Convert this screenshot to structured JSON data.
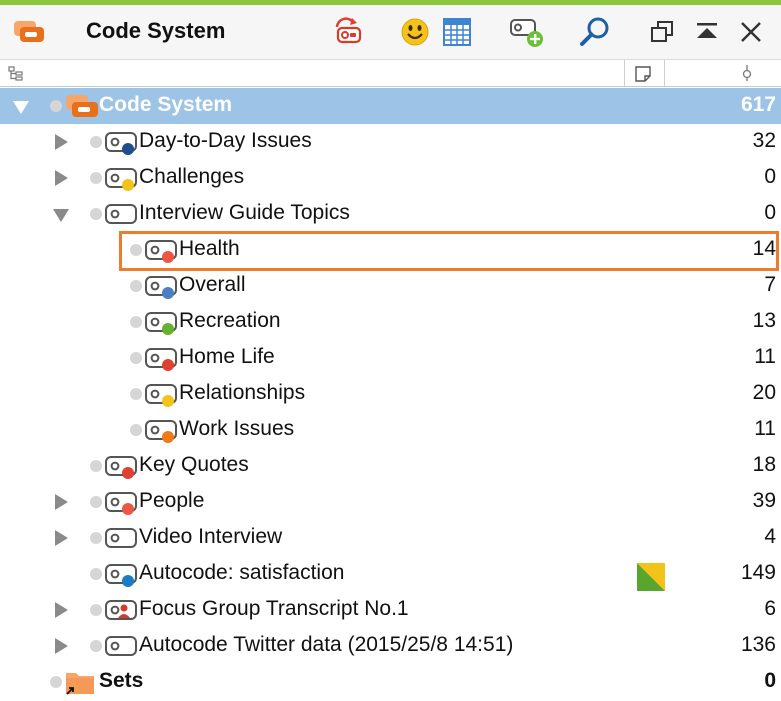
{
  "window": {
    "title": "Code System"
  },
  "toolbar": [
    {
      "name": "activate-codes-icon"
    },
    {
      "name": "emoticode-icon"
    },
    {
      "name": "code-matrix-icon"
    },
    {
      "name": "new-code-icon"
    },
    {
      "name": "search-icon"
    }
  ],
  "colors": {
    "accent_top": "#8cc63f",
    "selection": "#9dc3e6",
    "highlight": "#f07a2d"
  },
  "tree": {
    "root": {
      "label": "Code System",
      "count": "617"
    },
    "items": [
      {
        "label": "Day-to-Day Issues",
        "count": "32",
        "color": "#1f4e8c"
      },
      {
        "label": "Challenges",
        "count": "0",
        "color": "#f2c318"
      },
      {
        "label": "Interview Guide Topics",
        "count": "0",
        "color": ""
      },
      {
        "label": "Health",
        "count": "14",
        "color": "#ee5545"
      },
      {
        "label": "Overall",
        "count": "7",
        "color": "#4a7fc1"
      },
      {
        "label": "Recreation",
        "count": "13",
        "color": "#66b12e"
      },
      {
        "label": "Home Life",
        "count": "11",
        "color": "#e0402f"
      },
      {
        "label": "Relationships",
        "count": "20",
        "color": "#f2c318"
      },
      {
        "label": "Work Issues",
        "count": "11",
        "color": "#f07a1a"
      },
      {
        "label": "Key Quotes",
        "count": "18",
        "color": "#e0402f"
      },
      {
        "label": "People",
        "count": "39",
        "color": "#ee5545"
      },
      {
        "label": "Video Interview",
        "count": "4",
        "color": ""
      },
      {
        "label": "Autocode: satisfaction",
        "count": "149",
        "color": "#1a7bc6"
      },
      {
        "label": "Focus Group Transcript No.1",
        "count": "6",
        "color": "#d63a2a"
      },
      {
        "label": "Autocode Twitter data (2015/25/8 14:51)",
        "count": "136",
        "color": ""
      }
    ],
    "sets": {
      "label": "Sets",
      "count": "0"
    }
  }
}
